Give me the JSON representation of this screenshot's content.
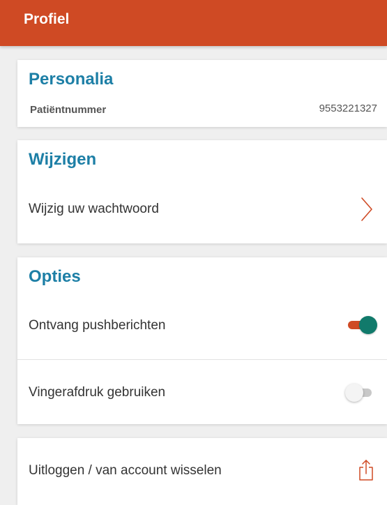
{
  "header": {
    "title": "Profiel",
    "color": "#cf4a24"
  },
  "personalia": {
    "title": "Personalia",
    "patient_label": "Patiëntnummer",
    "patient_value": "9553221327"
  },
  "wijzigen": {
    "title": "Wijzigen",
    "change_password_label": "Wijzig uw wachtwoord",
    "icon": "chevron-right-icon"
  },
  "opties": {
    "title": "Opties",
    "push": {
      "label": "Ontvang pushberichten",
      "enabled": true
    },
    "fingerprint": {
      "label": "Vingerafdruk gebruiken",
      "enabled": false
    }
  },
  "logout": {
    "label": "Uitloggen / van account wisselen",
    "icon": "share-icon"
  },
  "colors": {
    "accent": "#cf4a24",
    "section_title": "#1d7fa6",
    "toggle_on_knob": "#117a6b"
  }
}
